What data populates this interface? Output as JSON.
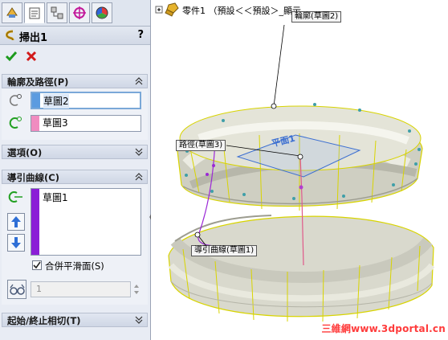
{
  "panel": {
    "title": "掃出1",
    "help": "?",
    "sections": {
      "profile_path": {
        "label": "輪廓及路徑(P)",
        "profile_value": "草圖2",
        "path_value": "草圖3"
      },
      "options": {
        "label": "選項(O)"
      },
      "guide_curves": {
        "label": "導引曲線(C)",
        "items": [
          "草圖1"
        ],
        "merge_label": "合併平滑面(S)",
        "merge_checked": true,
        "spin_value": "1"
      },
      "tangency": {
        "label": "起始/終止相切(T)"
      }
    }
  },
  "graphics": {
    "tree_label": "零件1 （預設＜＜預設＞_顯示",
    "callouts": {
      "profile": "輪廓(草圖2)",
      "path": "路徑(草圖3)",
      "guide": "導引曲線(草圖1)",
      "plane": "平面1"
    },
    "watermark": "三維網www.3dportal.cn"
  },
  "colors": {
    "profile_swatch": "#5b9be0",
    "path_swatch": "#f08cc0",
    "guide_swatch": "#8a1ed6",
    "model_edge": "#d8d400",
    "sketch_line": "#e05a8a"
  }
}
